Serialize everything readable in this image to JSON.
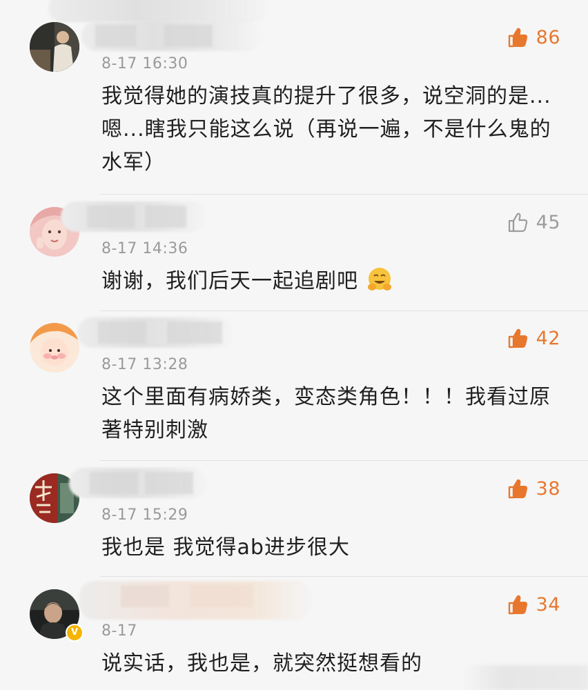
{
  "comments": [
    {
      "time": "8-17 16:30",
      "text": "我觉得她的演技真的提升了很多，说空洞的是...嗯...瞎我只能这么说（再说一遍，不是什么鬼的水军）",
      "likes": "86",
      "liked": true
    },
    {
      "time": "8-17 14:36",
      "text": "谢谢，我们后天一起追剧吧",
      "likes": "45",
      "liked": false,
      "emoji": "hugging-face"
    },
    {
      "time": "8-17 13:28",
      "text": "这个里面有病娇类，变态类角色！！！我看过原著特别刺激",
      "likes": "42",
      "liked": true
    },
    {
      "time": "8-17 15:29",
      "text": "我也是 我觉得ab进步很大",
      "likes": "38",
      "liked": true
    },
    {
      "time": "8-17",
      "text": "说实话，我也是，就突然挺想看的",
      "likes": "34",
      "liked": true,
      "verified_badge": "V"
    }
  ],
  "colors": {
    "accent": "#e8772e",
    "muted": "#9c9c9c",
    "background": "#f6f6f6"
  },
  "icons": {
    "like": "thumbs-up-icon"
  }
}
